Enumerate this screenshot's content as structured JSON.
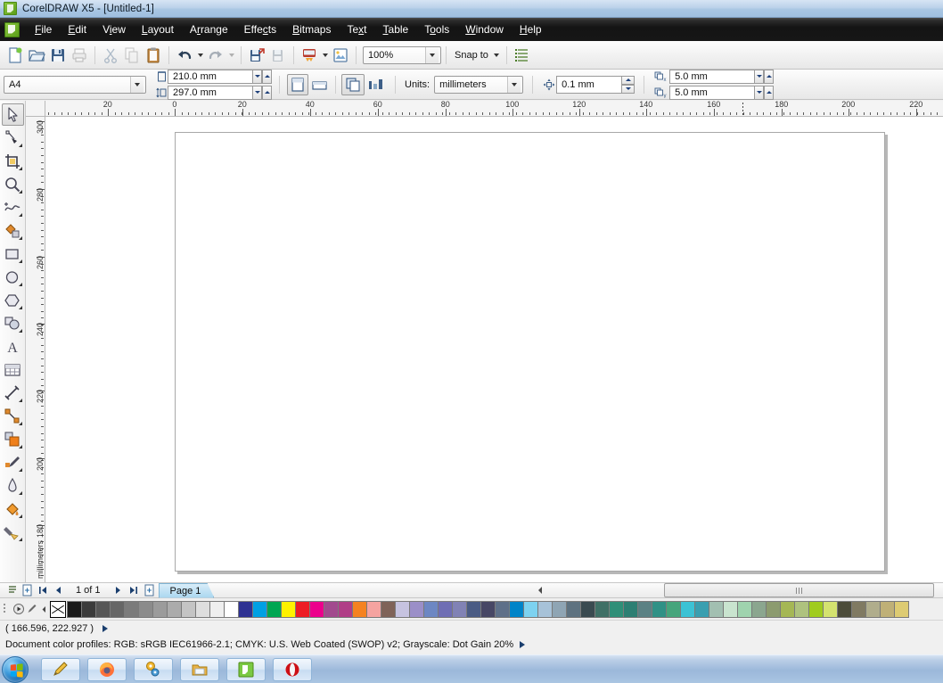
{
  "window": {
    "title": "CorelDRAW X5 - [Untitled-1]",
    "app_icon": "coreldraw-logo-icon"
  },
  "menubar": {
    "app_icon": "coreldraw-document-icon",
    "items": [
      {
        "label": "File",
        "mnemonic": 0
      },
      {
        "label": "Edit",
        "mnemonic": 0
      },
      {
        "label": "View",
        "mnemonic": 1
      },
      {
        "label": "Layout",
        "mnemonic": 0
      },
      {
        "label": "Arrange",
        "mnemonic": 1
      },
      {
        "label": "Effects",
        "mnemonic": 4
      },
      {
        "label": "Bitmaps",
        "mnemonic": 0
      },
      {
        "label": "Text",
        "mnemonic": 2
      },
      {
        "label": "Table",
        "mnemonic": 0
      },
      {
        "label": "Tools",
        "mnemonic": 1
      },
      {
        "label": "Window",
        "mnemonic": 0
      },
      {
        "label": "Help",
        "mnemonic": 0
      }
    ]
  },
  "standard_toolbar": {
    "buttons": [
      {
        "name": "new-document-button",
        "icon": "new-page-icon"
      },
      {
        "name": "open-document-button",
        "icon": "open-folder-icon"
      },
      {
        "name": "save-document-button",
        "icon": "floppy-disk-icon"
      },
      {
        "name": "print-button",
        "icon": "printer-icon",
        "disabled": true
      },
      {
        "name": "cut-button",
        "icon": "scissors-icon",
        "disabled": true
      },
      {
        "name": "copy-button",
        "icon": "copy-icon",
        "disabled": true
      },
      {
        "name": "paste-button",
        "icon": "clipboard-icon"
      },
      {
        "name": "undo-button",
        "icon": "undo-arrow-icon"
      },
      {
        "name": "redo-button",
        "icon": "redo-arrow-icon",
        "disabled": true
      },
      {
        "name": "import-button",
        "icon": "import-icon"
      },
      {
        "name": "export-button",
        "icon": "export-icon",
        "disabled": true
      },
      {
        "name": "application-launcher-button",
        "icon": "launcher-icon"
      },
      {
        "name": "corel-connect-button",
        "icon": "connect-icon"
      }
    ],
    "zoom_level": "100%",
    "snap_to_label": "Snap to",
    "options_button": "options-icon"
  },
  "property_bar": {
    "paper_type": "A4",
    "paper_width": "210.0 mm",
    "paper_height": "297.0 mm",
    "orientation_portrait": "portrait-icon",
    "orientation_landscape": "landscape-icon",
    "all_pages_icon": "all-pages-icon",
    "current_page_icon": "current-page-icon",
    "units_label": "Units:",
    "units_value": "millimeters",
    "nudge_offset": "0.1 mm",
    "duplicate_x": "5.0 mm",
    "duplicate_y": "5.0 mm"
  },
  "toolbox": {
    "tools": [
      {
        "name": "pick-tool",
        "icon": "arrow-cursor-icon",
        "active": true,
        "flyout": false
      },
      {
        "name": "shape-tool",
        "icon": "shape-node-icon",
        "active": false,
        "flyout": true
      },
      {
        "name": "crop-tool",
        "icon": "crop-icon",
        "active": false,
        "flyout": true
      },
      {
        "name": "zoom-tool",
        "icon": "magnifier-icon",
        "active": false,
        "flyout": true
      },
      {
        "name": "freehand-tool",
        "icon": "freehand-curve-icon",
        "active": false,
        "flyout": true
      },
      {
        "name": "smart-fill-tool",
        "icon": "smart-fill-icon",
        "active": false,
        "flyout": true
      },
      {
        "name": "rectangle-tool",
        "icon": "rectangle-icon",
        "active": false,
        "flyout": true
      },
      {
        "name": "ellipse-tool",
        "icon": "ellipse-icon",
        "active": false,
        "flyout": true
      },
      {
        "name": "polygon-tool",
        "icon": "polygon-icon",
        "active": false,
        "flyout": true
      },
      {
        "name": "basic-shapes-tool",
        "icon": "basic-shapes-icon",
        "active": false,
        "flyout": true
      },
      {
        "name": "text-tool",
        "icon": "letter-a-icon",
        "active": false,
        "flyout": false
      },
      {
        "name": "table-tool",
        "icon": "table-grid-icon",
        "active": false,
        "flyout": false
      },
      {
        "name": "dimension-tool",
        "icon": "dimension-line-icon",
        "active": false,
        "flyout": true
      },
      {
        "name": "connector-tool",
        "icon": "connector-icon",
        "active": false,
        "flyout": true
      },
      {
        "name": "blend-tool",
        "icon": "blend-squares-icon",
        "active": false,
        "flyout": true
      },
      {
        "name": "color-eyedropper-tool",
        "icon": "eyedropper-icon",
        "active": false,
        "flyout": true
      },
      {
        "name": "outline-tool",
        "icon": "pen-nib-icon",
        "active": false,
        "flyout": true
      },
      {
        "name": "fill-tool",
        "icon": "paint-bucket-icon",
        "active": false,
        "flyout": true
      },
      {
        "name": "interactive-fill-tool",
        "icon": "interactive-fill-icon",
        "active": false,
        "flyout": true
      }
    ]
  },
  "rulers": {
    "horizontal_labels": [
      "20",
      "0",
      "20",
      "40",
      "60",
      "80",
      "100",
      "120",
      "140",
      "160",
      "180",
      "200",
      "220"
    ],
    "horizontal_positions": [
      121,
      196,
      272,
      348,
      424,
      500,
      575,
      650,
      725,
      801,
      877,
      952,
      1028
    ],
    "vertical_labels": [
      "300",
      "280",
      "260",
      "240",
      "220",
      "200",
      "180"
    ],
    "vertical_positions": [
      136,
      212,
      288,
      363,
      438,
      514,
      589
    ],
    "unit_label": "millimeters"
  },
  "page_navigator": {
    "add-page-before-icon": "add-page-left-icon",
    "first_page_icon": "first-page-icon",
    "prev_page_icon": "prev-page-icon",
    "page_count_text": "1 of 1",
    "next_page_icon": "next-page-icon",
    "last_page_icon": "last-page-icon",
    "add-page-after-icon": "add-page-right-icon",
    "tabs": [
      {
        "label": "Page 1",
        "active": true
      }
    ]
  },
  "palette": {
    "no_color_swatch": "no-color-x-icon",
    "scroll_left_icon": "palette-scroll-left-icon",
    "expand_icon": "palette-expand-icon",
    "eyedropper_icon": "palette-eyedropper-icon",
    "colors": [
      "#1a1a1a",
      "#3b3b3b",
      "#565656",
      "#666666",
      "#7b7b7b",
      "#8b8b8b",
      "#9b9b9b",
      "#ababab",
      "#c4c4c4",
      "#dedede",
      "#efefef",
      "#ffffff",
      "#2e3192",
      "#00a0e3",
      "#00a652",
      "#fff200",
      "#ed1c24",
      "#ec008c",
      "#a24a8e",
      "#b03e87",
      "#f58220",
      "#f5a3a0",
      "#7f6359",
      "#c6c3e0",
      "#9b8fc8",
      "#6d87c3",
      "#6f6eb4",
      "#8182b5",
      "#4a5b84",
      "#474765",
      "#5e7089",
      "#0084c8",
      "#7dd2f0",
      "#a7c2d8",
      "#8fa5b4",
      "#5e7280",
      "#3a4a50",
      "#3f7066",
      "#2f8f78",
      "#2d7f73",
      "#5b8184",
      "#309186",
      "#46a57c",
      "#3cc2d4",
      "#3a9fb0",
      "#a2bfb1",
      "#c9e4cf",
      "#9fd3ae",
      "#8ba68f",
      "#8c9b6f",
      "#a5b755",
      "#aec27e",
      "#a0cc1e",
      "#d4e36f",
      "#4c4c3a",
      "#807a62",
      "#b0ad8c",
      "#bfb077",
      "#ddcb72"
    ]
  },
  "status_bar": {
    "coordinates": "( 166.596, 222.927 )",
    "color_profiles": "Document color profiles: RGB: sRGB IEC61966-2.1; CMYK: U.S. Web Coated (SWOP) v2; Grayscale: Dot Gain 20%",
    "expand_arrow_icon": "status-expand-arrow-icon"
  },
  "taskbar": {
    "start_button": "windows-start-orb-icon",
    "items": [
      {
        "name": "taskbar-item-editor",
        "icon": "yellow-pencil-icon"
      },
      {
        "name": "taskbar-item-firefox",
        "icon": "firefox-icon"
      },
      {
        "name": "taskbar-item-settings",
        "icon": "gears-icon"
      },
      {
        "name": "taskbar-item-explorer",
        "icon": "folder-explorer-icon"
      },
      {
        "name": "taskbar-item-coreldraw",
        "icon": "coreldraw-icon"
      },
      {
        "name": "taskbar-item-opera",
        "icon": "opera-icon"
      }
    ]
  },
  "colors": {
    "titlebar_accent": "#a9c6e3",
    "menubar_bg": "#161616",
    "toolbar_bg": "#f2f2f2",
    "page_tab_active": "#a9d6ef",
    "canvas_bg": "#ffffff"
  }
}
